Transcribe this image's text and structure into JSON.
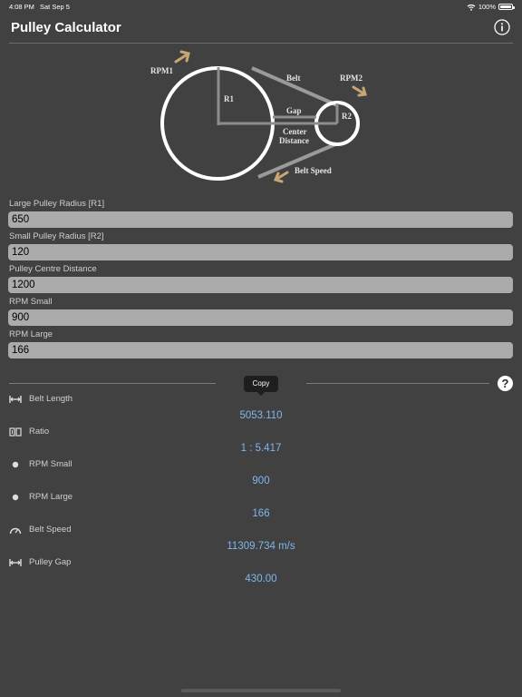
{
  "status": {
    "time": "4:08 PM",
    "date": "Sat Sep 5",
    "battery": "100%"
  },
  "header": {
    "title": "Pulley Calculator",
    "info_icon": "info-circle-icon"
  },
  "diagram": {
    "labels": {
      "rpm1": "RPM1",
      "rpm2": "RPM2",
      "belt": "Belt",
      "r1": "R1",
      "r2": "R2",
      "gap": "Gap",
      "center_line1": "Center",
      "center_line2": "Distance",
      "belt_speed": "Belt Speed"
    },
    "arrow_color": "#c8a673"
  },
  "inputs": [
    {
      "label": "Large Pulley Radius [R1]",
      "value": "650"
    },
    {
      "label": "Small Pulley Radius [R2]",
      "value": "120"
    },
    {
      "label": "Pulley Centre Distance",
      "value": "1200"
    },
    {
      "label": "RPM Small",
      "value": "900"
    },
    {
      "label": "RPM Large",
      "value": "166"
    }
  ],
  "tooltip": {
    "label": "Copy"
  },
  "help": {
    "label": "?"
  },
  "results": [
    {
      "label": "Belt Length",
      "value": "5053.110",
      "icon": "length-arrows-icon"
    },
    {
      "label": "Ratio",
      "value": "1 : 5.417",
      "icon": "ratio-icon"
    },
    {
      "label": "RPM Small",
      "value": "900",
      "icon": "dot-icon"
    },
    {
      "label": "RPM Large",
      "value": "166",
      "icon": "dot-icon"
    },
    {
      "label": "Belt Speed",
      "value": "11309.734 m/s",
      "icon": "speedometer-icon"
    },
    {
      "label": "Pulley Gap",
      "value": "430.00",
      "icon": "length-arrows-icon"
    }
  ],
  "colors": {
    "background": "#414141",
    "input_bg": "#ababab",
    "result_value": "#7fb6ee",
    "label": "#cfcfcf"
  }
}
